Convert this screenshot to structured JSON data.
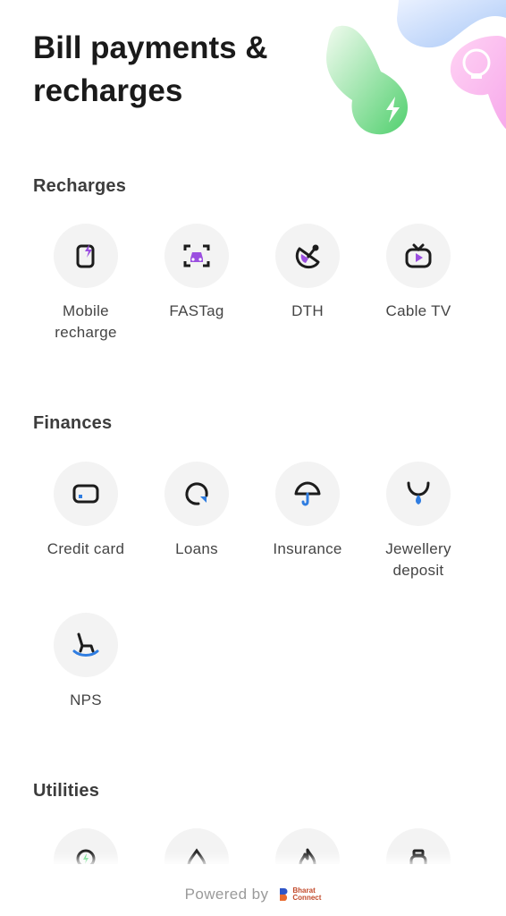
{
  "header": {
    "title": "Bill payments & recharges"
  },
  "sections": {
    "recharges": {
      "title": "Recharges",
      "items": [
        {
          "label": "Mobile recharge",
          "icon": "mobile-recharge-icon"
        },
        {
          "label": "FASTag",
          "icon": "fastag-car-icon"
        },
        {
          "label": "DTH",
          "icon": "dth-dish-icon"
        },
        {
          "label": "Cable TV",
          "icon": "cable-tv-icon"
        }
      ]
    },
    "finances": {
      "title": "Finances",
      "items": [
        {
          "label": "Credit card",
          "icon": "credit-card-icon"
        },
        {
          "label": "Loans",
          "icon": "loans-icon"
        },
        {
          "label": "Insurance",
          "icon": "umbrella-icon"
        },
        {
          "label": "Jewellery deposit",
          "icon": "necklace-icon"
        },
        {
          "label": "NPS",
          "icon": "rocking-chair-icon"
        }
      ]
    },
    "utilities": {
      "title": "Utilities",
      "items": [
        {
          "icon": "electricity-icon"
        },
        {
          "icon": "water-drop-icon"
        },
        {
          "icon": "gas-flame-icon"
        },
        {
          "icon": "lpg-cylinder-icon"
        }
      ]
    }
  },
  "footer": {
    "powered_by": "Powered by",
    "brand_line1": "Bharat",
    "brand_line2": "Connect"
  },
  "colors": {
    "accent_purple": "#9b4fe0",
    "accent_blue": "#2f7de1",
    "accent_green": "#3ccf63",
    "icon_dark": "#1c1c1c"
  }
}
